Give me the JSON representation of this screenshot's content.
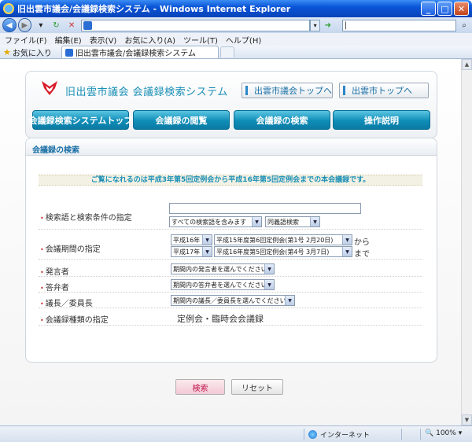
{
  "window": {
    "title": "旧出雲市議会/会議録検索システム - Windows Internet Explorer"
  },
  "address": {
    "url": "",
    "search_text": "|"
  },
  "menu": [
    "ファイル(F)",
    "編集(E)",
    "表示(V)",
    "お気に入り(A)",
    "ツール(T)",
    "ヘルプ(H)"
  ],
  "favorites": {
    "label": "お気に入り",
    "tab_title": "旧出雲市議会/会議録検索システム"
  },
  "header": {
    "site_title": "旧出雲市議会  会議録検索システム",
    "link_council": "出雲市議会トップへ",
    "link_city": "出雲市トップへ",
    "nav": [
      "会議録検索システムトップ",
      "会議録の閲覧",
      "会議録の検索",
      "操作説明"
    ]
  },
  "search": {
    "heading": "会議録の検索",
    "notice": "ご覧になれるのは平成3年第5回定例会から平成16年第5回定例会までの本会議録です。",
    "rows": {
      "keyword_label": "検索語と検索条件の指定",
      "keyword_value": "",
      "keyword_condition": "すべての検索語を含みます",
      "synonym": "同義語検索",
      "period_label": "会議期間の指定",
      "from_year": "平成16年",
      "from_session": "平成15年度第6回定例会(第1号 2月20日)",
      "from_suffix": "から",
      "to_year": "平成17年",
      "to_session": "平成16年度第5回定例会(第4号 3月7日)",
      "to_suffix": "まで",
      "speaker_label": "発言者",
      "speaker_value": "期間内の発言者を選んでください",
      "answerer_label": "答弁者",
      "answerer_value": "期間内の答弁者を選んでください",
      "chair_label": "議長／委員長",
      "chair_value": "期間内の議長／委員長を選んでください",
      "type_label": "会議録種類の指定",
      "type_value": "定例会・臨時会会議録"
    },
    "search_button": "検索",
    "reset_button": "リセット"
  },
  "status": {
    "zone": "インターネット",
    "zoom": "100%"
  },
  "colors": {
    "accent": "#1a8fb5",
    "nav_tab": "#0f8db8",
    "search_button": "#c0154a"
  }
}
